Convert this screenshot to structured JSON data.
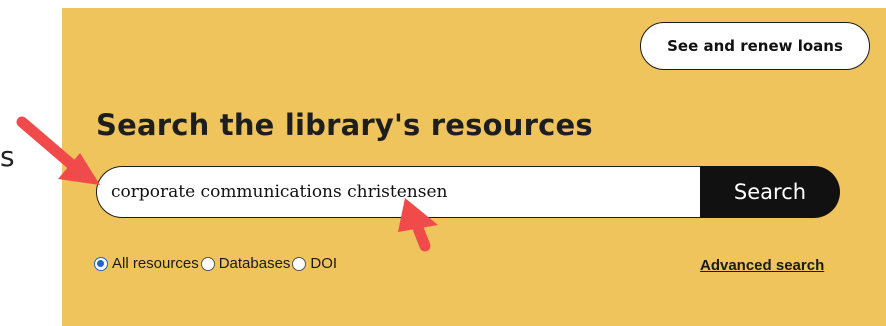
{
  "left_fragment": "s",
  "header": {
    "loans_label": "See and renew loans"
  },
  "main": {
    "title": "Search the library's resources",
    "search": {
      "value": "corporate communications christensen",
      "button_label": "Search"
    },
    "filters": [
      {
        "label": "All resources",
        "checked": true
      },
      {
        "label": "Databases",
        "checked": false
      },
      {
        "label": "DOI",
        "checked": false
      }
    ],
    "advanced_label": "Advanced search"
  },
  "colors": {
    "panel": "#efc45c",
    "arrow": "#f04a4a",
    "radio_selected": "#1a64d6"
  },
  "icons": [
    "arrow-annotation-icon",
    "arrow-annotation-icon"
  ]
}
